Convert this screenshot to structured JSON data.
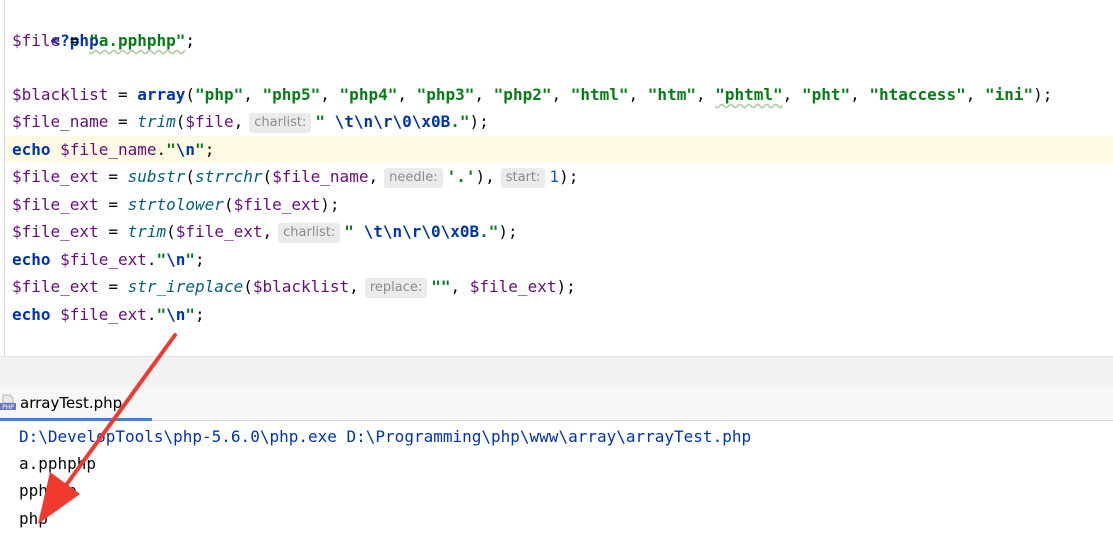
{
  "editor": {
    "lines": {
      "l1": {
        "tag": "<?php"
      },
      "l2": {
        "var": "$file",
        "op": " = ",
        "str": "\"a.pphphp\"",
        "end": ";"
      },
      "l4": {
        "var": "$blacklist",
        "op": " = ",
        "fn": "array",
        "open": "(",
        "items": [
          "\"php\"",
          "\"php5\"",
          "\"php4\"",
          "\"php3\"",
          "\"php2\"",
          "\"html\"",
          "\"htm\"",
          "\"phtml\"",
          "\"pht\"",
          "\"htaccess\"",
          "\"ini\""
        ],
        "close": ");"
      },
      "l5": {
        "var": "$file_name",
        "op": " = ",
        "fn": "trim",
        "arg1": "$file",
        "hint": "charlist:",
        "str_q": "\" ",
        "esc": "\\t\\n\\r\\0\\x0B",
        "str_end": ".\"",
        "end": ");"
      },
      "l6": {
        "kw": "echo",
        "var": " $file_name",
        "dot": ".",
        "str_q": "\"",
        "esc": "\\n",
        "str_end": "\"",
        "end": ";"
      },
      "l7": {
        "var": "$file_ext",
        "op": " = ",
        "fn1": "substr",
        "fn2": "strrchr",
        "arg1": "$file_name",
        "hint1": "needle:",
        "str": "'.'",
        "hint2": "start:",
        "num": "1",
        "end": ");"
      },
      "l8": {
        "var": "$file_ext",
        "op": " = ",
        "fn": "strtolower",
        "arg1": "$file_ext",
        "end": ");"
      },
      "l9": {
        "var": "$file_ext",
        "op": " = ",
        "fn": "trim",
        "arg1": "$file_ext",
        "hint": "charlist:",
        "str_q": "\" ",
        "esc": "\\t\\n\\r\\0\\x0B",
        "str_end": ".\"",
        "end": ");"
      },
      "l10": {
        "kw": "echo",
        "var": " $file_ext",
        "dot": ".",
        "str_q": "\"",
        "esc": "\\n",
        "str_end": "\"",
        "end": ";"
      },
      "l11": {
        "var": "$file_ext",
        "op": " = ",
        "fn": "str_ireplace",
        "arg1": "$blacklist",
        "hint": "replace:",
        "str": "\"\"",
        "arg3": "$file_ext",
        "end": ");"
      },
      "l12": {
        "kw": "echo",
        "var": " $file_ext",
        "dot": ".",
        "str_q": "\"",
        "esc": "\\n",
        "str_end": "\"",
        "end": ";"
      }
    }
  },
  "run_window": {
    "tab_label": "arrayTest.php",
    "icon": "php-file-icon"
  },
  "console": {
    "command": "D:\\DevelopTools\\php-5.6.0\\php.exe D:\\Programming\\php\\www\\array\\arrayTest.php",
    "output": [
      "a.pphphp",
      "pphphp",
      "php"
    ]
  },
  "annotation": {
    "color": "#f03a2e",
    "icon": "red-arrow-annotation"
  }
}
